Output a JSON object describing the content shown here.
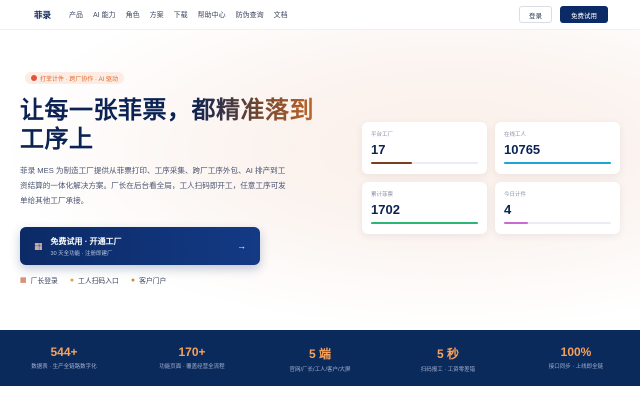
{
  "nav": {
    "logo": "菲录",
    "items": [
      "产品",
      "AI 能力",
      "角色",
      "方案",
      "下载",
      "帮助中心",
      "防伪查询",
      "文档"
    ],
    "login_label": "登录",
    "trial_label": "免费试用"
  },
  "hero": {
    "badge": "打菲计件 · 跨厂协作 · AI 驱动",
    "headline_plain": "让每一张菲票，",
    "headline_accent": "都精准落到",
    "headline_line2": "工序上",
    "description": "菲录 MES 为制造工厂提供从菲票打印、工序采集、跨厂工序外包、AI 排产到工资结算的一体化解决方案。厂长在后台看全局，工人扫码即开工，任意工序可发单给其他工厂承接。",
    "cta": {
      "icon": "factory-icon",
      "title": "免费试用 · 开通工厂",
      "subtitle": "30 天全功能 · 注册即建厂",
      "arrow": "→"
    },
    "portals": [
      {
        "icon": "factory-icon",
        "label": "厂长登录"
      },
      {
        "icon": "worker-icon",
        "label": "工人扫码入口"
      },
      {
        "icon": "customer-icon",
        "label": "客户门户"
      }
    ]
  },
  "metrics": [
    {
      "label": "平台工厂",
      "value": "17",
      "progress": 0.38,
      "color": "#7a3e1c"
    },
    {
      "label": "在线工人",
      "value": "10765",
      "progress": 1.0,
      "color": "#1ca6d6"
    },
    {
      "label": "累计菲票",
      "value": "1702",
      "progress": 1.0,
      "color": "#2bb673"
    },
    {
      "label": "今日计件",
      "value": "4",
      "progress": 0.22,
      "color": "#c86ad1"
    }
  ],
  "stats": [
    {
      "value": "544+",
      "label": "数据表 · 生产全链路数字化"
    },
    {
      "value": "170+",
      "label": "功能页面 · 覆盖经营全流程"
    },
    {
      "value": "5 端",
      "label": "官网/厂长/工人/客户/大屏"
    },
    {
      "value": "5 秒",
      "label": "扫码报工 · 工资零差错"
    },
    {
      "value": "100%",
      "label": "接口同步 · 上线即全链"
    }
  ]
}
